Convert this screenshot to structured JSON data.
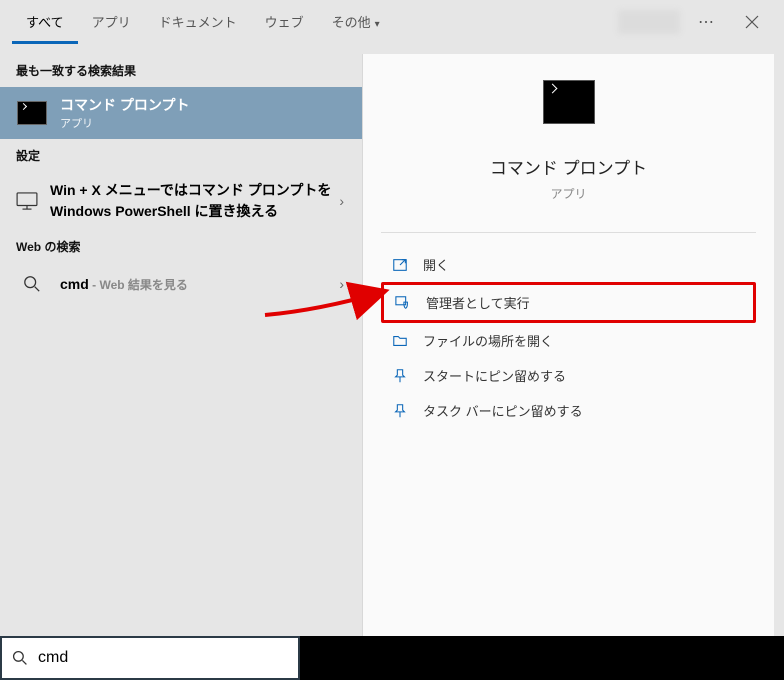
{
  "tabs": {
    "all": "すべて",
    "apps": "アプリ",
    "documents": "ドキュメント",
    "web": "ウェブ",
    "other": "その他"
  },
  "sections": {
    "best": "最も一致する検索結果",
    "settings": "設定",
    "web": "Web の検索"
  },
  "topResult": {
    "title": "コマンド プロンプト",
    "subtitle": "アプリ"
  },
  "settingsResult": {
    "line": "Win + X メニューではコマンド プロンプトを Windows PowerShell に置き換える"
  },
  "webResult": {
    "query": "cmd",
    "suffix": " - Web 結果を見る"
  },
  "detail": {
    "title": "コマンド プロンプト",
    "subtitle": "アプリ"
  },
  "actions": {
    "open": "開く",
    "runAdmin": "管理者として実行",
    "fileLocation": "ファイルの場所を開く",
    "pinStart": "スタートにピン留めする",
    "pinTaskbar": "タスク バーにピン留めする"
  },
  "search": {
    "value": "cmd"
  }
}
